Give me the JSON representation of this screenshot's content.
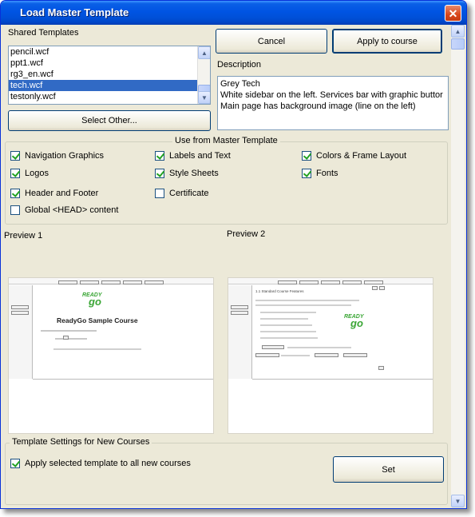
{
  "window": {
    "title": "Load Master Template",
    "close_glyph": "✕"
  },
  "shared_templates": {
    "label": "Shared Templates",
    "items": [
      "pencil.wcf",
      "ppt1.wcf",
      "rg3_en.wcf",
      "tech.wcf",
      "testonly.wcf"
    ],
    "selected": "tech.wcf"
  },
  "buttons": {
    "cancel": "Cancel",
    "apply": "Apply to course",
    "select_other": "Select Other...",
    "set": "Set"
  },
  "description": {
    "label": "Description",
    "lines": [
      "Grey Tech",
      "White sidebar on the left. Services bar with graphic buttor",
      "Main page has background image (line on the left)"
    ]
  },
  "use_from_master": {
    "legend": "Use from Master Template",
    "options": [
      {
        "label": "Navigation Graphics",
        "checked": true
      },
      {
        "label": "Labels and Text",
        "checked": true
      },
      {
        "label": "Colors & Frame Layout",
        "checked": true
      },
      {
        "label": "Logos",
        "checked": true
      },
      {
        "label": "Style Sheets",
        "checked": true
      },
      {
        "label": "Fonts",
        "checked": true
      },
      {
        "label": "Header and Footer",
        "checked": true
      },
      {
        "label": "Certificate",
        "checked": false
      },
      {
        "label": "Global <HEAD> content",
        "checked": false
      }
    ]
  },
  "previews": {
    "preview1_label": "Preview 1",
    "preview2_label": "Preview 2",
    "preview1": {
      "course_title": "ReadyGo Sample Course",
      "logo_top": "READY",
      "logo_bottom": "go"
    },
    "preview2": {
      "heading": "1.1 Standard Course Features",
      "logo_top": "READY",
      "logo_bottom": "go"
    }
  },
  "template_settings": {
    "legend": "Template Settings for New Courses",
    "apply_all": {
      "label": "Apply selected template to all new courses",
      "checked": true
    }
  },
  "colors": {
    "title_bar": "#0054e3",
    "selection": "#316ac5",
    "dialog_bg": "#ece9d8",
    "logo_green": "#3aa635",
    "logo_orange": "#f7a21b"
  }
}
